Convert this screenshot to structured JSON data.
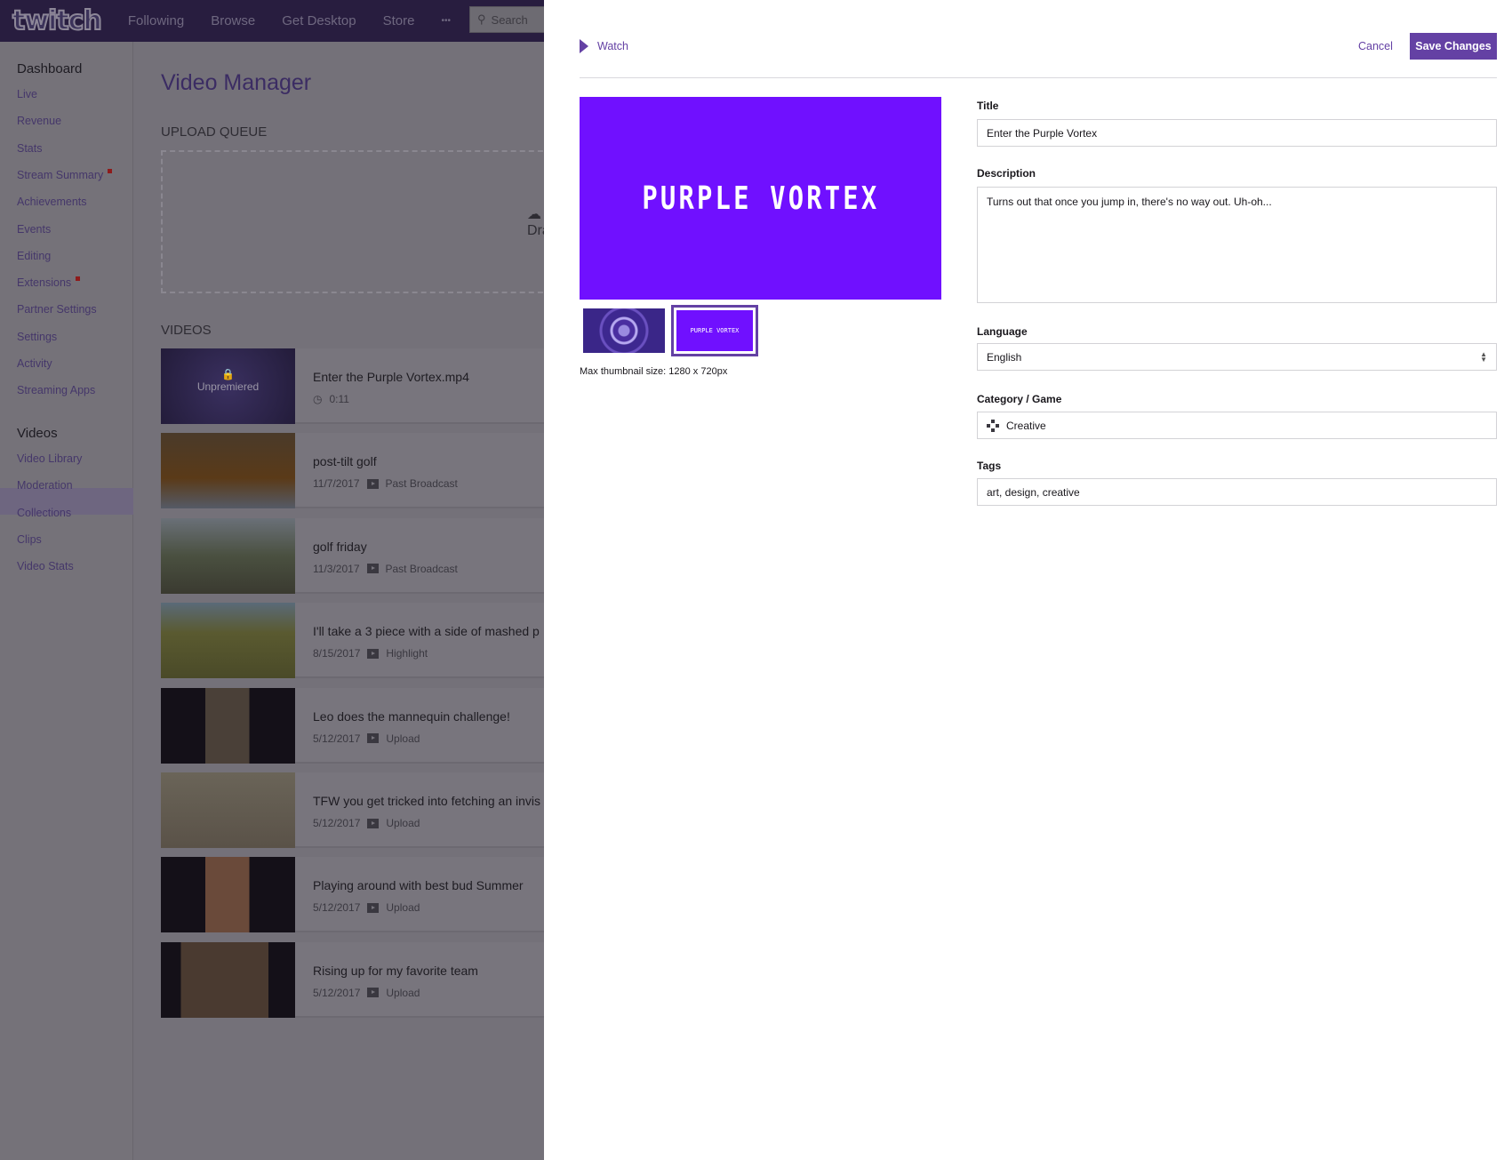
{
  "header": {
    "logo": "twitch",
    "nav": [
      "Following",
      "Browse",
      "Get Desktop",
      "Store",
      "•••"
    ],
    "search_placeholder": "Search"
  },
  "sidebar": {
    "dashboard_heading": "Dashboard",
    "dashboard_items": [
      {
        "label": "Live"
      },
      {
        "label": "Revenue"
      },
      {
        "label": "Stats"
      },
      {
        "label": "Stream Summary",
        "badge": true
      },
      {
        "label": "Achievements"
      },
      {
        "label": "Events"
      },
      {
        "label": "Editing"
      },
      {
        "label": "Extensions",
        "badge": true
      },
      {
        "label": "Partner Settings"
      },
      {
        "label": "Settings"
      },
      {
        "label": "Activity"
      },
      {
        "label": "Streaming Apps"
      }
    ],
    "videos_heading": "Videos",
    "video_items": [
      {
        "label": "Video Library",
        "selected": true
      },
      {
        "label": "Moderation"
      },
      {
        "label": "Collections"
      },
      {
        "label": "Clips"
      },
      {
        "label": "Video Stats"
      }
    ]
  },
  "main": {
    "title": "Video Manager",
    "upload_queue_label": "UPLOAD QUEUE",
    "drop_text": "Dra",
    "videos_label": "VIDEOS",
    "videos": [
      {
        "title": "Enter the Purple Vortex.mp4",
        "overlay": "Unpremiered",
        "duration": "0:11"
      },
      {
        "title": "post-tilt golf",
        "date": "11/7/2017",
        "type": "Past Broadcast"
      },
      {
        "title": "golf friday",
        "date": "11/3/2017",
        "type": "Past Broadcast"
      },
      {
        "title": "I'll take a 3 piece with a side of mashed p",
        "date": "8/15/2017",
        "type": "Highlight"
      },
      {
        "title": "Leo does the mannequin challenge!",
        "date": "5/12/2017",
        "type": "Upload"
      },
      {
        "title": "TFW you get tricked into fetching an invis",
        "date": "5/12/2017",
        "type": "Upload"
      },
      {
        "title": "Playing around with best bud Summer",
        "date": "5/12/2017",
        "type": "Upload"
      },
      {
        "title": "Rising up for my favorite team",
        "date": "5/12/2017",
        "type": "Upload"
      }
    ]
  },
  "panel": {
    "watch_label": "Watch",
    "cancel_label": "Cancel",
    "save_label": "Save Changes",
    "thumbnail_text": "PURPLE VORTEX",
    "max_thumbnail": "Max thumbnail size: 1280 x 720px",
    "form": {
      "title_label": "Title",
      "title_value": "Enter the Purple Vortex",
      "description_label": "Description",
      "description_value": "Turns out that once you jump in, there's no way out. Uh-oh...",
      "language_label": "Language",
      "language_value": "English",
      "category_label": "Category / Game",
      "category_value": "Creative",
      "tags_label": "Tags",
      "tags_value": "art, design, creative"
    }
  },
  "colors": {
    "brand": "#6441a4",
    "thumbnail": "#7010ff"
  }
}
